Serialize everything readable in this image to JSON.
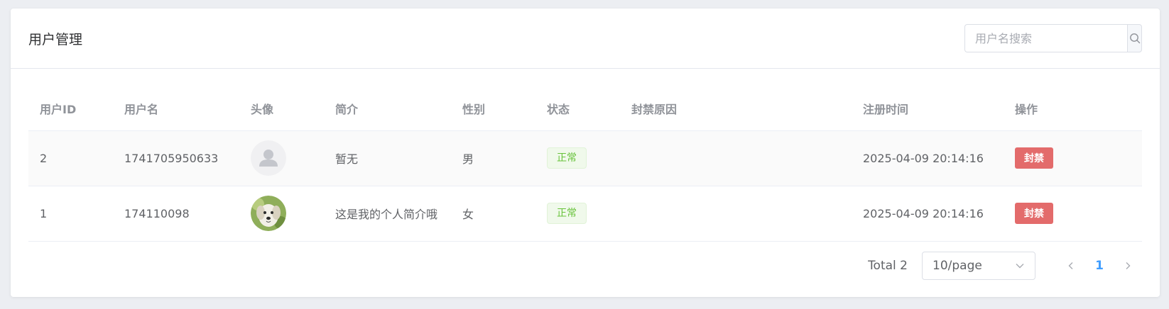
{
  "colors": {
    "primary": "#409eff",
    "success": "#67c23a",
    "success_bg": "#f0f9eb",
    "success_border": "#e1f3d8",
    "danger": "#e36b6b"
  },
  "header": {
    "title": "用户管理",
    "search_placeholder": "用户名搜索",
    "search_icon": "search-icon"
  },
  "table": {
    "columns": [
      "用户ID",
      "用户名",
      "头像",
      "简介",
      "性别",
      "状态",
      "封禁原因",
      "注册时间",
      "操作"
    ],
    "rows": [
      {
        "id": "2",
        "username": "1741705950633",
        "avatar": "default-user-avatar",
        "bio": "暂无",
        "gender": "男",
        "status": "正常",
        "ban_reason": "",
        "register_time": "2025-04-09 20:14:16",
        "action": "封禁"
      },
      {
        "id": "1",
        "username": "174110098",
        "avatar": "dog-photo-avatar",
        "bio": "这是我的个人简介哦",
        "gender": "女",
        "status": "正常",
        "ban_reason": "",
        "register_time": "2025-04-09 20:14:16",
        "action": "封禁"
      }
    ]
  },
  "pagination": {
    "total_label": "Total 2",
    "page_size": "10/page",
    "current_page": "1",
    "prev_icon": "chevron-left-icon",
    "next_icon": "chevron-right-icon"
  }
}
